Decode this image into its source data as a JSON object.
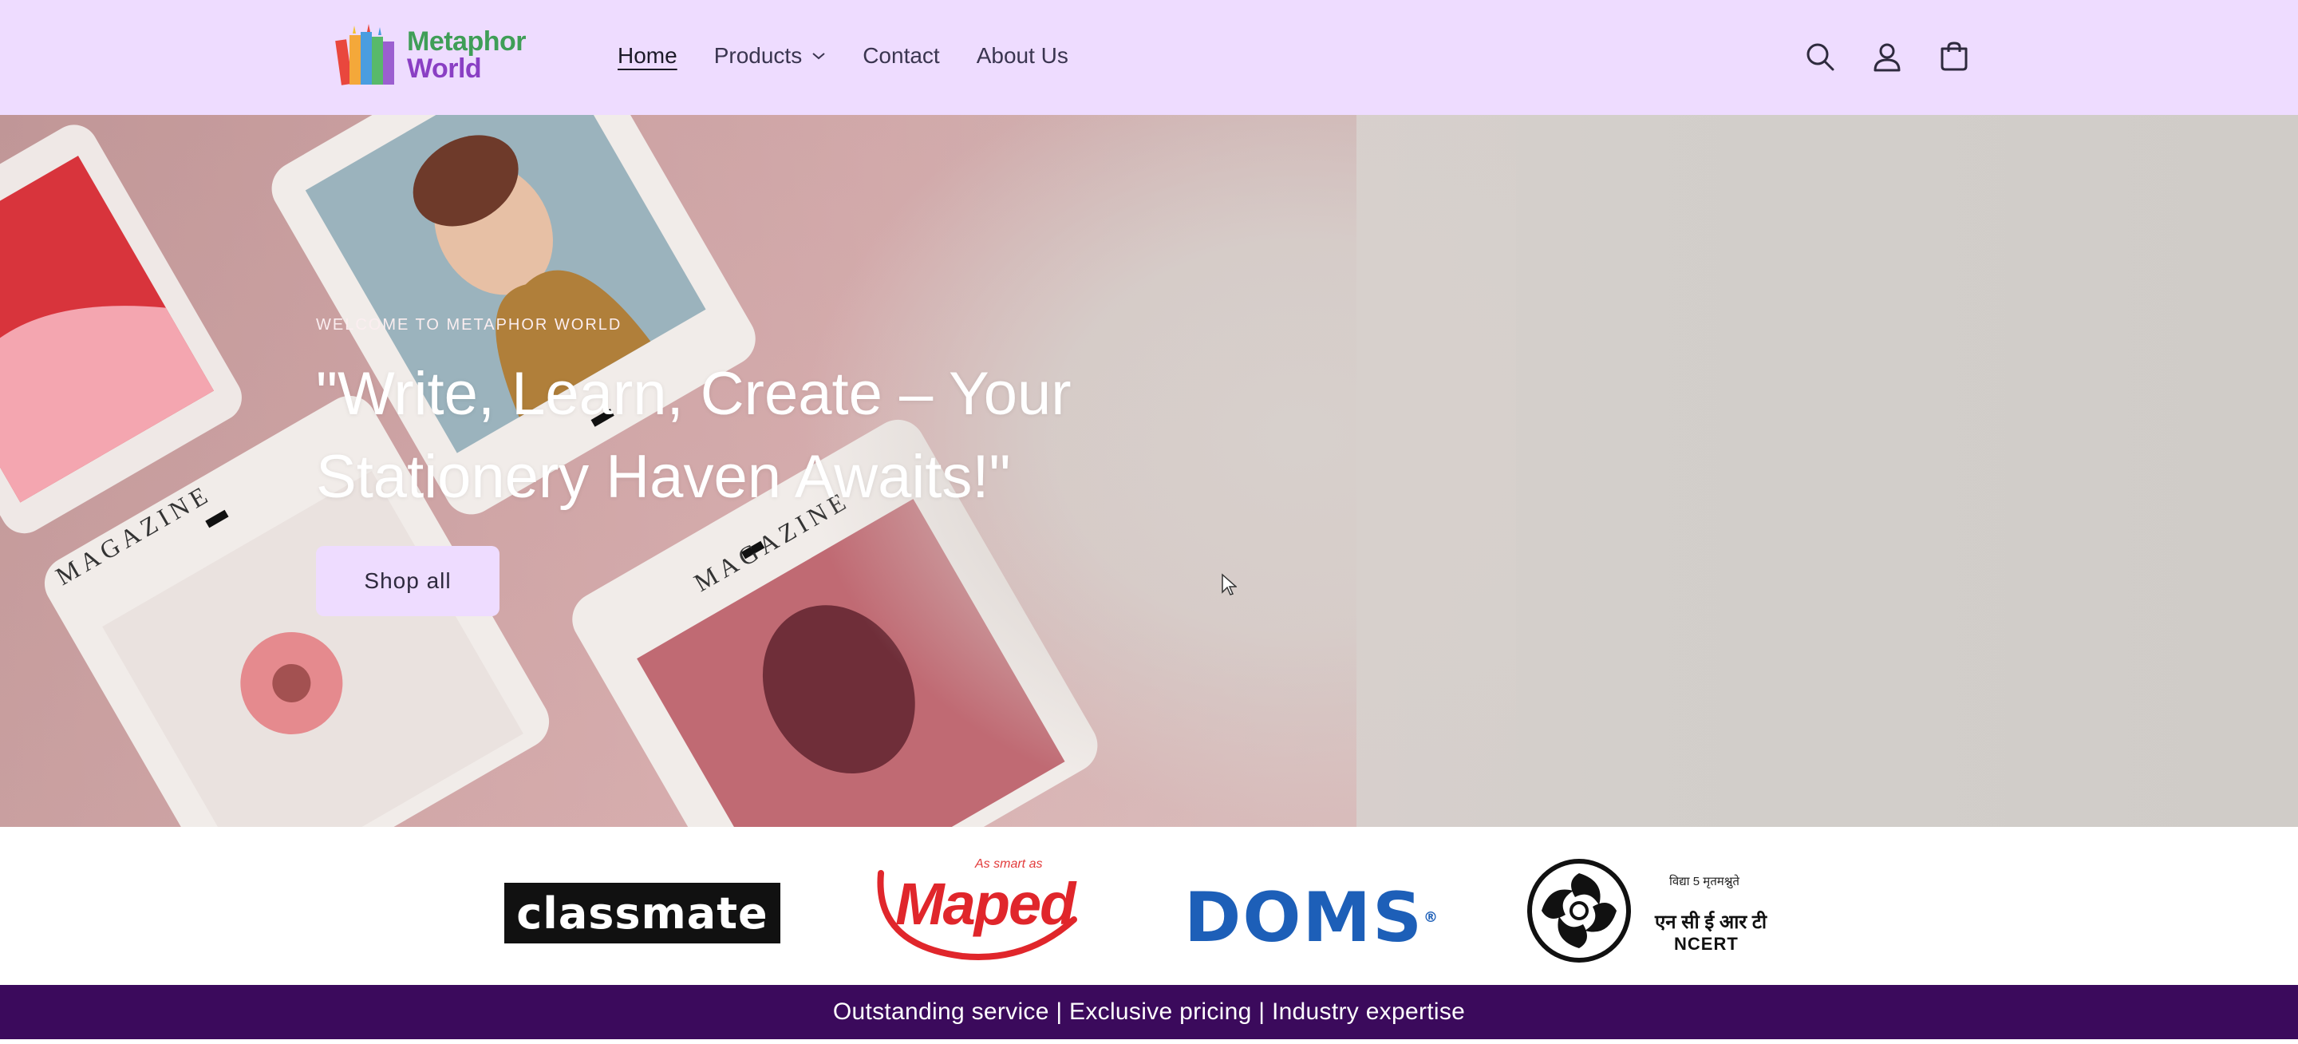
{
  "header": {
    "logo": {
      "line1": "Metaphor",
      "line2": "World",
      "line1_color": "#3f9e57",
      "line2_color": "#8a3fc4"
    },
    "nav": [
      {
        "label": "Home",
        "active": true
      },
      {
        "label": "Products",
        "has_dropdown": true
      },
      {
        "label": "Contact"
      },
      {
        "label": "About Us"
      }
    ],
    "icons": [
      "search-icon",
      "account-icon",
      "cart-icon"
    ],
    "background": "#eedcff"
  },
  "hero": {
    "eyebrow": "WELCOME TO METAPHOR WORLD",
    "headline": "\"Write, Learn, Create – Your Stationery Haven Awaits!\"",
    "button_label": "Shop all",
    "magazine_label": "MAGAZINE"
  },
  "brands": {
    "classmate": "classmate",
    "maped_tagline": "As smart as",
    "maped": "Maped",
    "doms": "DOMS",
    "ncert_hindi_motto": "विद्या 5 मृतमश्नुते",
    "ncert_hindi": "एन सी ई आर टी",
    "ncert_en": "NCERT"
  },
  "announcement": {
    "text": "Outstanding service | Exclusive pricing | Industry expertise",
    "background": "#3b0a5c"
  }
}
